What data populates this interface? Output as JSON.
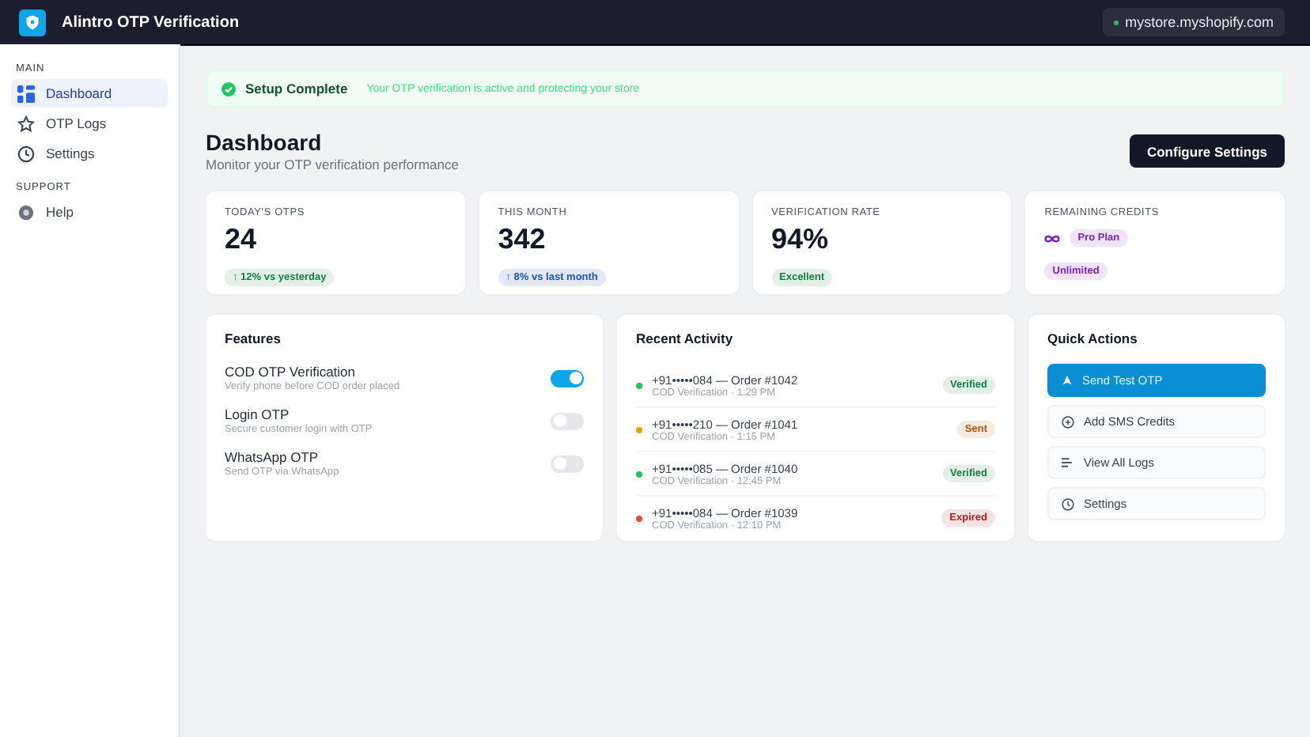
{
  "app": {
    "title": "Alintro OTP Verification",
    "store": "mystore.myshopify.com"
  },
  "sidebar": {
    "sections": [
      {
        "heading": "MAIN",
        "items": [
          {
            "label": "Dashboard",
            "selected": true
          },
          {
            "label": "OTP Logs",
            "selected": false
          },
          {
            "label": "Settings",
            "selected": false
          }
        ]
      },
      {
        "heading": "SUPPORT",
        "items": [
          {
            "label": "Help",
            "selected": false
          }
        ]
      }
    ]
  },
  "banner": {
    "title": "Setup Complete",
    "message": "Your OTP verification is active and protecting your store"
  },
  "header": {
    "title": "Dashboard",
    "subtitle": "Monitor your OTP verification performance",
    "button": "Configure Settings"
  },
  "stats": [
    {
      "kind": "value",
      "label": "TODAY'S OTPS",
      "value": "24",
      "badges": [
        {
          "text": "↑ 12% vs yesterday",
          "color": "#15803d"
        }
      ]
    },
    {
      "kind": "value",
      "label": "THIS MONTH",
      "value": "342",
      "badges": [
        {
          "text": "↑ 8% vs last month",
          "color": "#1d4ed8"
        }
      ]
    },
    {
      "kind": "value",
      "label": "VERIFICATION RATE",
      "value": "94%",
      "badges": [
        {
          "text": "Excellent",
          "color": "#15803d"
        }
      ]
    },
    {
      "kind": "plan",
      "label": "REMAINING CREDITS",
      "badges": [
        {
          "text": "Pro Plan",
          "color": "#7e22ce"
        },
        {
          "text": "Unlimited",
          "color": "#7e22ce"
        }
      ]
    }
  ],
  "features": {
    "title": "Features",
    "items": [
      {
        "name": "COD OTP Verification",
        "description": "Verify phone before COD order placed",
        "on": true
      },
      {
        "name": "Login OTP",
        "description": "Secure customer login with OTP",
        "on": false
      },
      {
        "name": "WhatsApp OTP",
        "description": "Send OTP via WhatsApp",
        "on": false
      }
    ]
  },
  "activity": {
    "title": "Recent Activity",
    "items": [
      {
        "title": "+91•••••084 — Order #1042",
        "detail": "COD Verification · 1:29 PM",
        "color": "#22c55e",
        "status": {
          "text": "Verified",
          "color": "#15803d"
        }
      },
      {
        "title": "+91•••••210 — Order #1041",
        "detail": "COD Verification · 1:15 PM",
        "color": "#f59e0b",
        "status": {
          "text": "Sent",
          "color": "#b45309"
        }
      },
      {
        "title": "+91•••••085 — Order #1040",
        "detail": "COD Verification · 12:45 PM",
        "color": "#22c55e",
        "status": {
          "text": "Verified",
          "color": "#15803d"
        }
      },
      {
        "title": "+91•••••084 — Order #1039",
        "detail": "COD Verification · 12:10 PM",
        "color": "#ef4444",
        "status": {
          "text": "Expired",
          "color": "#b91c1c"
        }
      }
    ]
  },
  "quick_actions": {
    "title": "Quick Actions",
    "items": [
      {
        "label": "Send Test OTP",
        "kind": "primary"
      },
      {
        "label": "Add SMS Credits",
        "kind": "secondary"
      },
      {
        "label": "View All Logs",
        "kind": "secondary"
      },
      {
        "label": "Settings",
        "kind": "secondary"
      }
    ]
  }
}
